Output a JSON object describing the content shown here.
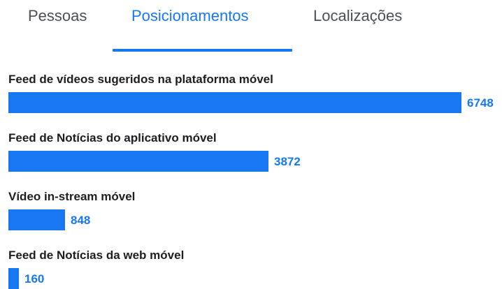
{
  "tabs": [
    {
      "label": "Pessoas",
      "active": false
    },
    {
      "label": "Posicionamentos",
      "active": true
    },
    {
      "label": "Localizações",
      "active": false
    }
  ],
  "colors": {
    "accent": "#1877f2",
    "tab_inactive": "#4b4f56",
    "label_text": "#1c1e21"
  },
  "chart_data": {
    "type": "bar",
    "orientation": "horizontal",
    "categories": [
      "Feed de vídeos sugeridos na plataforma móvel",
      "Feed de Notícias do aplicativo móvel",
      "Vídeo in-stream móvel",
      "Feed de Notícias da web móvel"
    ],
    "values": [
      6748,
      3872,
      848,
      160
    ],
    "value_labels": [
      "6748",
      "3872",
      "848",
      "160"
    ],
    "title": "",
    "xlabel": "",
    "ylabel": "",
    "xlim": [
      0,
      6748
    ],
    "grid": false,
    "legend": "none"
  }
}
